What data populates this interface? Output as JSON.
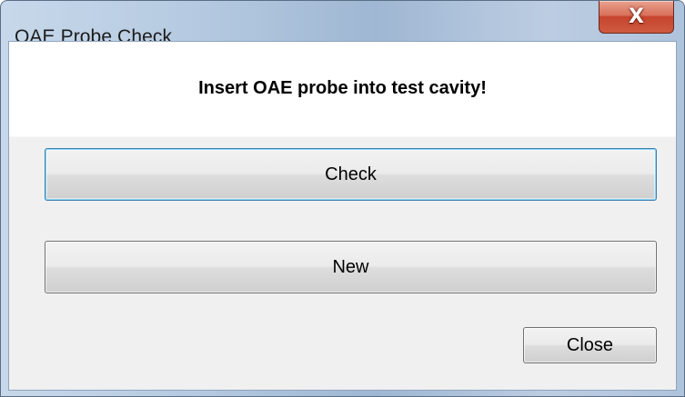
{
  "window": {
    "title": "OAE Probe Check",
    "close_glyph": "X"
  },
  "dialog": {
    "message": "Insert OAE probe into test cavity!",
    "check_label": "Check",
    "new_label": "New",
    "close_label": "Close"
  },
  "colors": {
    "title_close_red": "#c6452f",
    "focus_border": "#3c7fb1",
    "client_lower_bg": "#f0f0f0",
    "client_upper_bg": "#ffffff"
  },
  "icons": {
    "window_close": "close-icon"
  }
}
